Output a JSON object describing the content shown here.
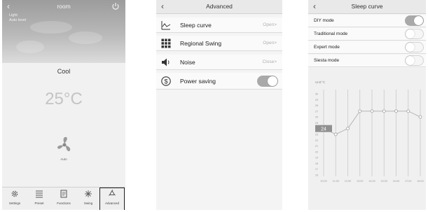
{
  "screen1": {
    "title": "room",
    "info_lines": [
      "Light",
      "Auto level"
    ],
    "mode": "Cool",
    "temperature": "25°C",
    "fan_label": "Auto",
    "tabs": [
      {
        "label": "Settings",
        "icon": "gear-icon"
      },
      {
        "label": "Preset",
        "icon": "list-icon"
      },
      {
        "label": "Functions",
        "icon": "document-icon"
      },
      {
        "label": "Swing",
        "icon": "swing-icon"
      },
      {
        "label": "Advanced",
        "icon": "recycle-icon",
        "active": true
      }
    ]
  },
  "screen2": {
    "title": "Advanced",
    "items": [
      {
        "label": "Sleep curve",
        "value": "Open>",
        "icon": "curve-icon"
      },
      {
        "label": "Regional Swing",
        "value": "Open>",
        "icon": "grid-icon"
      },
      {
        "label": "Noise",
        "value": "Close>",
        "icon": "speaker-icon"
      },
      {
        "label": "Power saving",
        "toggle": true,
        "icon": "dollar-icon"
      }
    ]
  },
  "screen3": {
    "title": "Sleep curve",
    "modes": [
      {
        "label": "DIY mode",
        "on": true
      },
      {
        "label": "Traditional mode",
        "on": false
      },
      {
        "label": "Expert mode",
        "on": false
      },
      {
        "label": "Siesta mode",
        "on": false
      }
    ]
  },
  "chart_data": {
    "type": "line",
    "ylabel": "Unit:°C",
    "x": [
      "10:00",
      "11:00",
      "12:00",
      "13:00",
      "14:00",
      "15:00",
      "16:00",
      "17:00",
      "18:00"
    ],
    "values": [
      24,
      23,
      24,
      27,
      27,
      27,
      27,
      27,
      26
    ],
    "highlight_label": "24",
    "highlight_index": 0,
    "yticks": [
      "30",
      "29",
      "28",
      "27",
      "26",
      "25",
      "24",
      "23",
      "22",
      "21",
      "20",
      "19",
      "18",
      "17",
      "16"
    ],
    "ylim": [
      16,
      30
    ],
    "colors": {
      "line": "#b5b5b5",
      "point": "#ffffff",
      "highlight": "#909090",
      "grid": "#c8c8c8"
    }
  }
}
